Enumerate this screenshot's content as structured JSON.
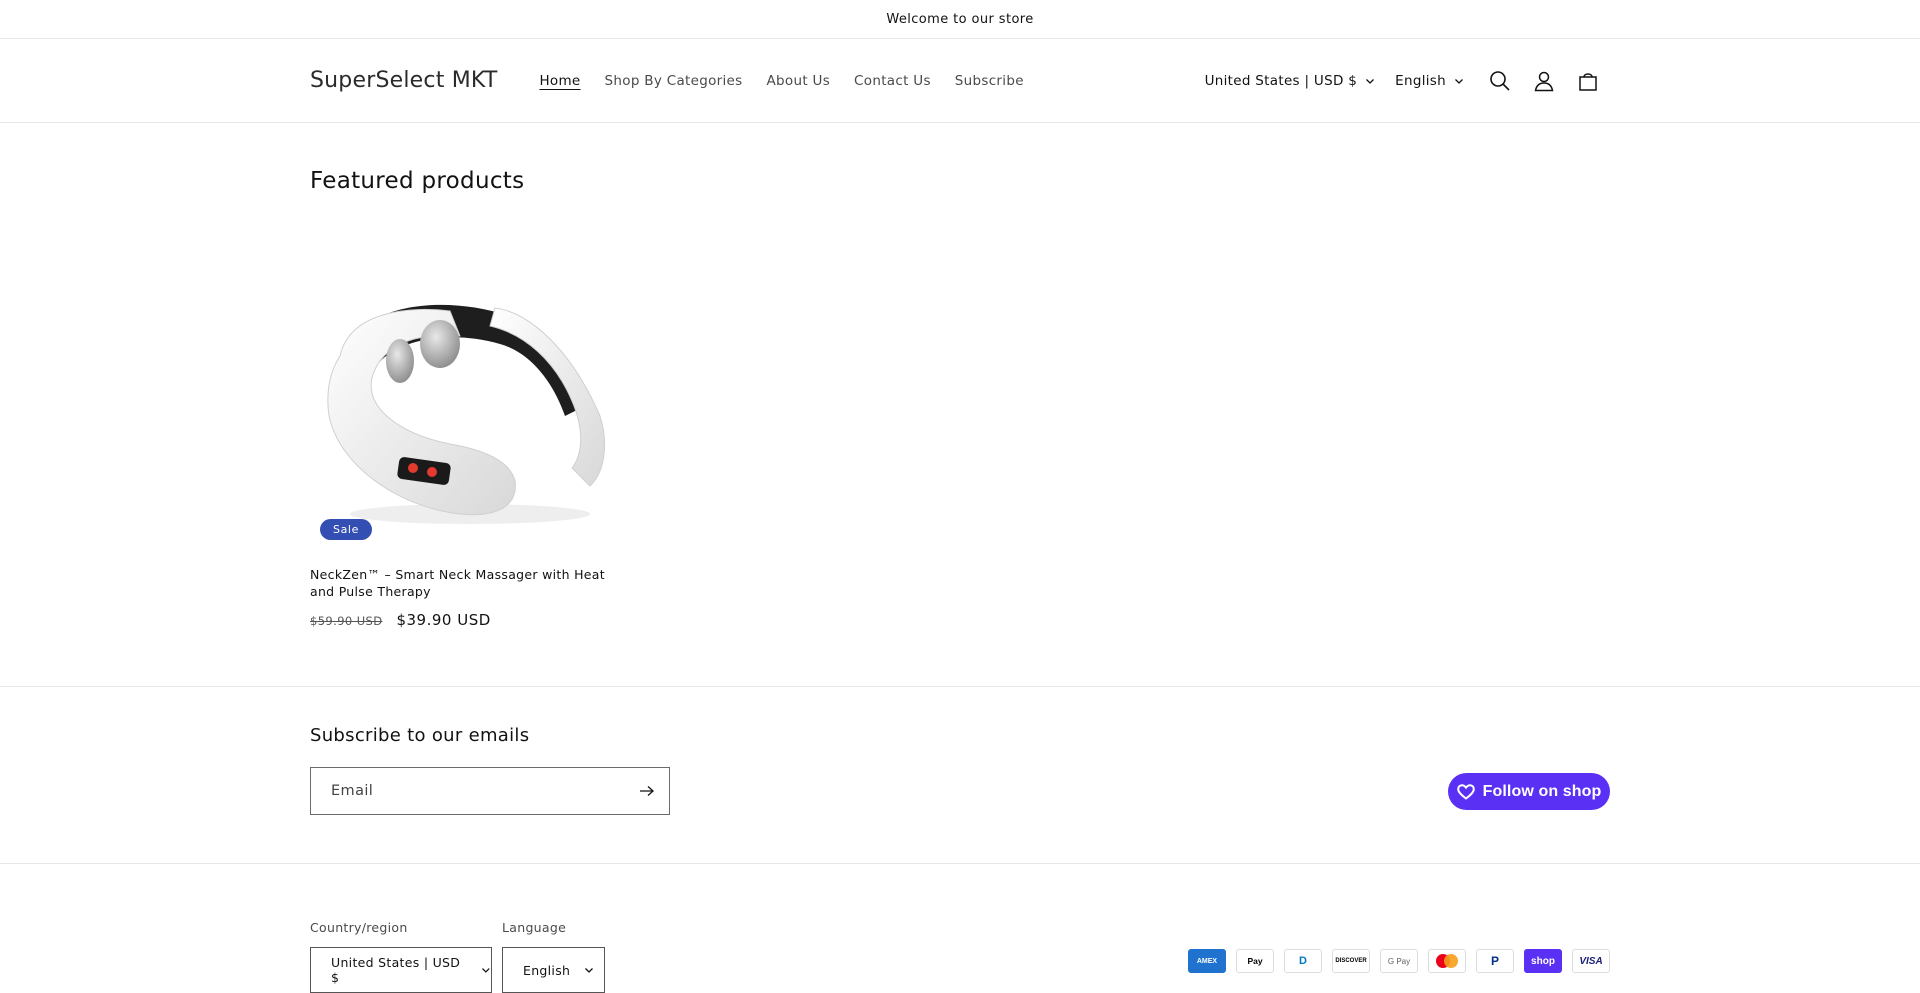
{
  "announcement": {
    "text": "Welcome to our store"
  },
  "header": {
    "logo": "SuperSelect MKT",
    "nav": [
      {
        "label": "Home",
        "active": true
      },
      {
        "label": "Shop By Categories"
      },
      {
        "label": "About Us"
      },
      {
        "label": "Contact Us"
      },
      {
        "label": "Subscribe"
      }
    ],
    "country": "United States | USD $",
    "language": "English",
    "icons": [
      "search-icon",
      "account-icon",
      "cart-icon"
    ]
  },
  "featured": {
    "heading": "Featured products",
    "products": [
      {
        "title": "NeckZen™ – Smart Neck Massager with Heat and Pulse Therapy",
        "badge": "Sale",
        "price_old": "$59.90 USD",
        "price_new": "$39.90 USD"
      }
    ]
  },
  "newsletter": {
    "heading": "Subscribe to our emails",
    "email_placeholder": "Email",
    "follow_label": "Follow on shop"
  },
  "footer": {
    "country_label": "Country/region",
    "country_value": "United States | USD $",
    "language_label": "Language",
    "language_value": "English",
    "payments": [
      {
        "name": "American Express",
        "short": "AMEX"
      },
      {
        "name": "Apple Pay",
        "short": "Pay"
      },
      {
        "name": "Diners Club",
        "short": "D"
      },
      {
        "name": "Discover",
        "short": "DISCOVER"
      },
      {
        "name": "Google Pay",
        "short": "G Pay"
      },
      {
        "name": "Mastercard",
        "short": ""
      },
      {
        "name": "PayPal",
        "short": "P"
      },
      {
        "name": "Shop Pay",
        "short": "shop"
      },
      {
        "name": "Visa",
        "short": "VISA"
      }
    ]
  },
  "colors": {
    "sale_badge": "#334fb4",
    "shop_purple": "#5a31f4",
    "text": "#121212",
    "border": "#e6e6e6"
  }
}
